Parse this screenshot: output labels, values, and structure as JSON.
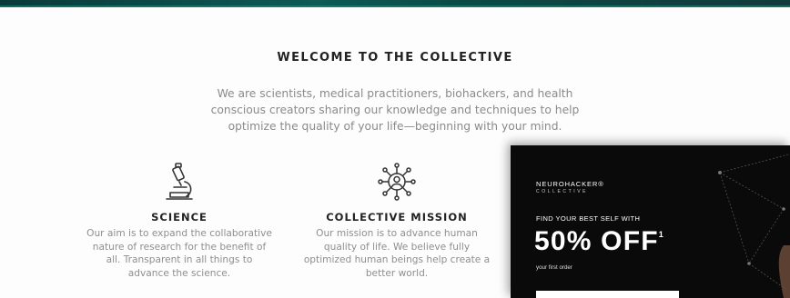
{
  "section": {
    "title": "WELCOME TO THE COLLECTIVE",
    "intro_line1": "We are scientists, medical practitioners, biohackers, and health",
    "intro_line2": "conscious creators sharing our knowledge and techniques to help",
    "intro_line3": "optimize the quality of your life—beginning with your mind."
  },
  "columns": [
    {
      "icon": "microscope-icon",
      "heading": "SCIENCE",
      "line1": "Our aim is to expand the collaborative",
      "line2": "nature of research for the benefit of",
      "line3": "all. Transparent in all things to",
      "line4": "advance the science."
    },
    {
      "icon": "collective-network-icon",
      "heading": "COLLECTIVE MISSION",
      "line1": "Our mission is to advance human",
      "line2": "quality of life. We believe fully",
      "line3": "optimized human beings help create a",
      "line4": "better world."
    }
  ],
  "promo": {
    "brand": "NEUROHACKER",
    "brand_mark": "®",
    "brand_sub": "COLLECTIVE",
    "headline_small": "FIND YOUR BEST SELF WITH",
    "headline_big": "50% OFF",
    "headline_sup": "1",
    "subline": "your first order",
    "email_placeholder": ""
  },
  "colors": {
    "top_band": "#0e5a55",
    "promo_bg": "#0a0a0a",
    "heading_text": "#222222",
    "body_text": "#8a8a8a"
  }
}
